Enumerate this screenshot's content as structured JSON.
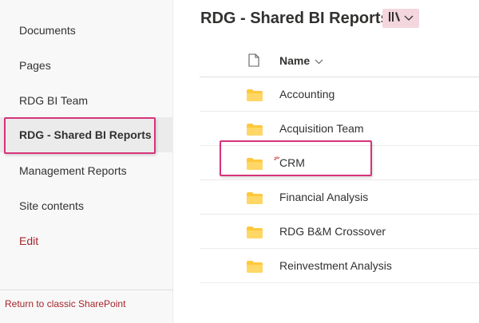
{
  "sidebar": {
    "items": [
      {
        "label": "Documents"
      },
      {
        "label": "Pages"
      },
      {
        "label": "RDG BI Team"
      },
      {
        "label": "RDG - Shared BI Reports",
        "selected": true
      },
      {
        "label": "Management Reports"
      },
      {
        "label": "Site contents"
      },
      {
        "label": "Edit"
      }
    ],
    "footer_link": "Return to classic SharePoint"
  },
  "library": {
    "title": "RDG - Shared BI Reports",
    "view_icon": "library-icon",
    "view_dropdown_icon": "chevron-down-icon"
  },
  "list": {
    "column_header": "Name",
    "header_icon": "document-icon",
    "sort_icon": "chevron-down-icon",
    "rows": [
      {
        "name": "Accounting"
      },
      {
        "name": "Acquisition Team"
      },
      {
        "name": "CRM",
        "highlighted": true
      },
      {
        "name": "Financial Analysis"
      },
      {
        "name": "RDG B&M Crossover"
      },
      {
        "name": "Reinvestment Analysis"
      }
    ]
  },
  "colors": {
    "accent_pink": "#d6337a",
    "folder": "#ffc83d",
    "edit_link": "#a4262c"
  }
}
